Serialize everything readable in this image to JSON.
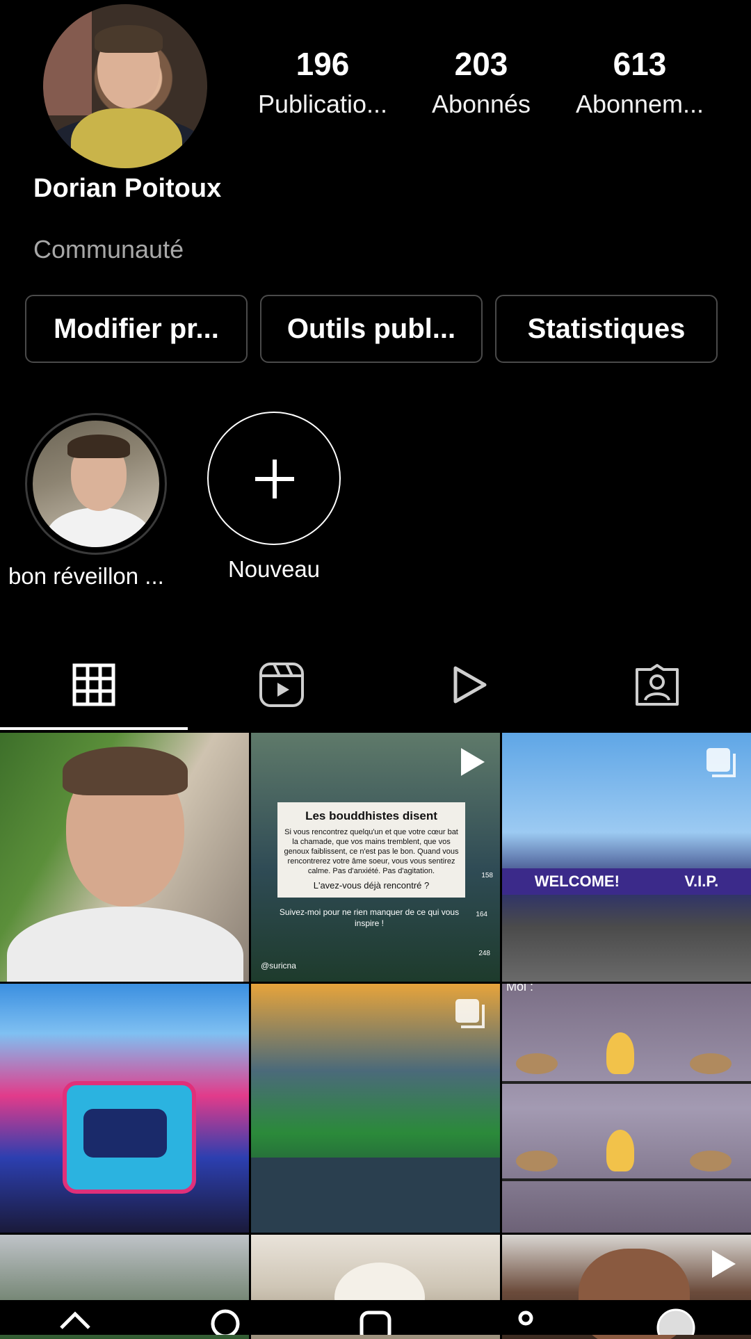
{
  "profile": {
    "name": "Dorian Poitoux",
    "category": "Communauté"
  },
  "stats": [
    {
      "value": "196",
      "label": "Publicatio..."
    },
    {
      "value": "203",
      "label": "Abonnés"
    },
    {
      "value": "613",
      "label": "Abonnem..."
    }
  ],
  "actions": {
    "edit_profile": "Modifier pr...",
    "pro_tools": "Outils publ...",
    "insights": "Statistiques"
  },
  "highlights": [
    {
      "label": "bon réveillon ..."
    },
    {
      "label": "Nouveau"
    }
  ],
  "tabs": [
    {
      "icon": "grid-icon",
      "active": true
    },
    {
      "icon": "reels-icon",
      "active": false
    },
    {
      "icon": "play-icon",
      "active": false
    },
    {
      "icon": "tagged-icon",
      "active": false
    }
  ],
  "posts": {
    "quote": {
      "title": "Les bouddhistes disent",
      "body": "Si vous rencontrez quelqu'un et que votre cœur bat la chamade, que vos mains tremblent, que vos genoux faiblissent, ce n'est pas le bon. Quand vous rencontrerez votre âme soeur, vous vous sentirez calme. Pas d'anxiété. Pas d'agitation.",
      "ask": "L'avez-vous déjà rencontré ?",
      "follow": "Suivez-moi pour ne rien manquer de ce qui vous inspire !",
      "handle": "@suricna",
      "likes": "158",
      "comments": "164",
      "shares": "248"
    },
    "festival_banner": [
      "WELCOME!",
      "V.I.P."
    ],
    "comic_caption": "Moi :"
  },
  "colors": {
    "background": "#000000",
    "secondary_text": "#a8a8a8",
    "button_border": "#4a4a4a"
  }
}
